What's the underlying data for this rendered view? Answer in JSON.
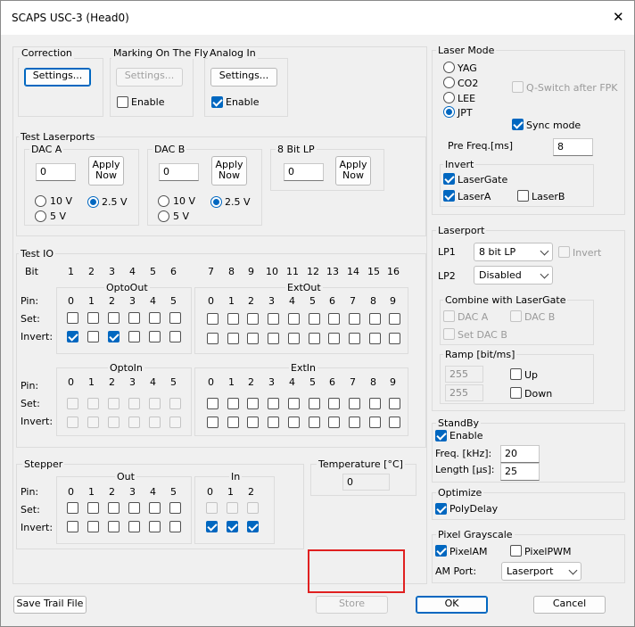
{
  "window": {
    "title": "SCAPS USC-3 (Head0)"
  },
  "correction": {
    "label": "Correction",
    "settings": "Settings..."
  },
  "marking": {
    "label": "Marking On The Fly",
    "settings": "Settings...",
    "enable": "Enable",
    "enable_checked": false
  },
  "analog": {
    "label": "Analog In",
    "settings": "Settings...",
    "enable": "Enable",
    "enable_checked": true
  },
  "test_laserports": {
    "label": "Test Laserports",
    "dac_a": {
      "label": "DAC A",
      "value": "0",
      "apply": [
        "Apply",
        "Now"
      ],
      "opt10": "10 V",
      "opt25": "2.5 V",
      "opt5": "5 V",
      "selected": "2.5 V"
    },
    "dac_b": {
      "label": "DAC B",
      "value": "0",
      "apply": [
        "Apply",
        "Now"
      ],
      "opt10": "10 V",
      "opt25": "2.5 V",
      "opt5": "5 V",
      "selected": "2.5 V"
    },
    "lp8": {
      "label": "8 Bit LP",
      "value": "0",
      "apply": [
        "Apply",
        "Now"
      ]
    }
  },
  "test_io": {
    "label": "Test IO",
    "bit_label": "Bit",
    "bits_left": [
      "1",
      "2",
      "3",
      "4",
      "5",
      "6"
    ],
    "bits_right": [
      "7",
      "8",
      "9",
      "10",
      "11",
      "12",
      "13",
      "14",
      "15",
      "16"
    ],
    "pin": "Pin:",
    "set": "Set:",
    "invert": "Invert:",
    "optoout": {
      "label": "OptoOut",
      "pins": [
        "0",
        "1",
        "2",
        "3",
        "4",
        "5"
      ],
      "invert_checked": [
        true,
        false,
        true,
        false,
        false,
        false
      ]
    },
    "extout": {
      "label": "ExtOut",
      "pins": [
        "0",
        "1",
        "2",
        "3",
        "4",
        "5",
        "6",
        "7",
        "8",
        "9"
      ]
    },
    "optoin": {
      "label": "OptoIn",
      "pins": [
        "0",
        "1",
        "2",
        "3",
        "4",
        "5"
      ]
    },
    "extin": {
      "label": "ExtIn",
      "pins": [
        "0",
        "1",
        "2",
        "3",
        "4",
        "5",
        "6",
        "7",
        "8",
        "9"
      ]
    }
  },
  "stepper": {
    "label": "Stepper",
    "pin": "Pin:",
    "set": "Set:",
    "invert": "Invert:",
    "out": {
      "label": "Out",
      "pins": [
        "0",
        "1",
        "2",
        "3",
        "4",
        "5"
      ]
    },
    "in": {
      "label": "In",
      "pins": [
        "0",
        "1",
        "2"
      ],
      "invert_checked": [
        true,
        true,
        true
      ]
    }
  },
  "temperature": {
    "label": "Temperature [°C]",
    "value": "0"
  },
  "laser_mode": {
    "label": "Laser Mode",
    "options": [
      "YAG",
      "CO2",
      "LEE",
      "JPT"
    ],
    "selected": "JPT",
    "qswitch": "Q-Switch after FPK",
    "sync": "Sync mode",
    "sync_checked": true,
    "prefreq_label": "Pre Freq.[ms]",
    "prefreq": "8",
    "invert": {
      "label": "Invert",
      "lasergate": "LaserGate",
      "lasergate_checked": true,
      "lasera": "LaserA",
      "lasera_checked": true,
      "laserb": "LaserB",
      "laserb_checked": false
    }
  },
  "laserport": {
    "label": "Laserport",
    "lp1_label": "LP1",
    "lp1": "8 bit LP",
    "lp1_invert": "Invert",
    "lp2_label": "LP2",
    "lp2": "Disabled",
    "combine": {
      "label": "Combine with LaserGate",
      "daca": "DAC A",
      "dacb": "DAC B",
      "setdacb": "Set DAC B"
    },
    "ramp": {
      "label": "Ramp [bit/ms]",
      "up_value": "255",
      "down_value": "255",
      "up": "Up",
      "down": "Down"
    }
  },
  "standby": {
    "label": "StandBy",
    "enable": "Enable",
    "enable_checked": true,
    "freq_label": "Freq. [kHz]:",
    "freq": "20",
    "length_label": "Length [µs]:",
    "length": "25"
  },
  "optimize": {
    "label": "Optimize",
    "polydelay": "PolyDelay",
    "polydelay_checked": true
  },
  "pixel": {
    "label": "Pixel Grayscale",
    "pixelam": "PixelAM",
    "pixelam_checked": true,
    "pixelpwm": "PixelPWM",
    "pixelpwm_checked": false,
    "amport_label": "AM Port:",
    "amport": "Laserport"
  },
  "footer": {
    "save_trail": "Save Trail File",
    "store": "Store",
    "ok": "OK",
    "cancel": "Cancel"
  }
}
